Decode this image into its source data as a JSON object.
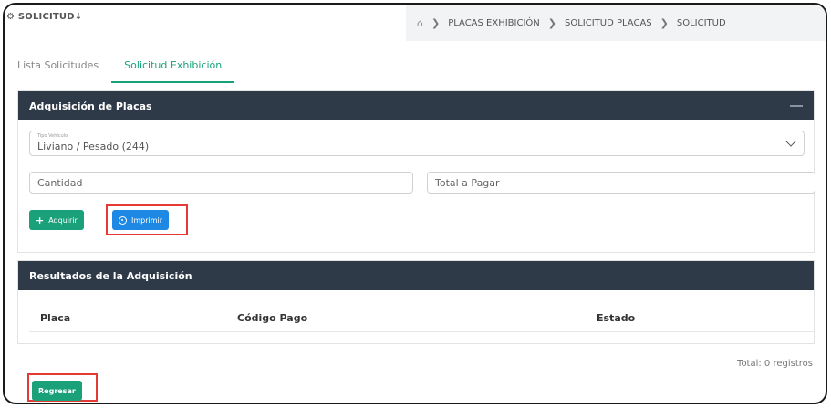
{
  "header": {
    "app_title": "SOLICITUD",
    "title_icon": "gear-icon",
    "breadcrumb": {
      "home_icon": "home-icon",
      "items": [
        "PLACAS EXHIBICIÓN",
        "SOLICITUD PLACAS",
        "SOLICITUD"
      ]
    }
  },
  "tabs": [
    {
      "label": "Lista Solicitudes",
      "active": false
    },
    {
      "label": "Solicitud Exhibición",
      "active": true
    }
  ],
  "acquisition_panel": {
    "title": "Adquisición de Placas",
    "vehicle_type": {
      "label": "Tipo Vehículo",
      "value": "Liviano / Pesado (244)"
    },
    "quantity_placeholder": "Cantidad",
    "total_placeholder": "Total a Pagar",
    "acquire_label": "Adquirir",
    "print_label": "Imprimir"
  },
  "results_panel": {
    "title": "Resultados de la Adquisición",
    "columns": [
      "Placa",
      "Código Pago",
      "Estado"
    ],
    "rows": []
  },
  "footer": {
    "total_text": "Total: 0 registros",
    "back_label": "Regresar"
  },
  "colors": {
    "accent_green": "#1aa179",
    "print_blue": "#1e88e5",
    "panel_header": "#2f3a48",
    "highlight_red": "#e53935"
  }
}
